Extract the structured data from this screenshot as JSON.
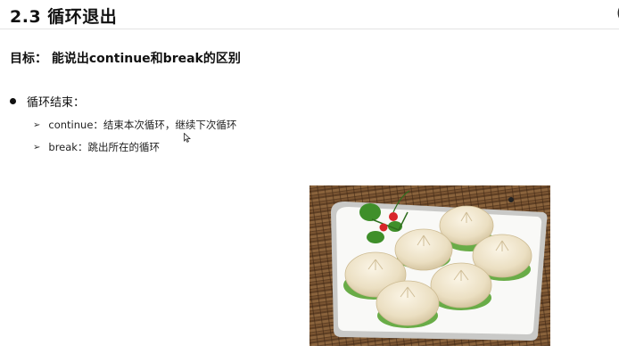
{
  "slide": {
    "title": "2.3 循环退出",
    "goal": "目标： 能说出continue和break的区别",
    "bullet": "循环结束：",
    "subitems": [
      {
        "text": "continue：结束本次循环，继续下次循环"
      },
      {
        "text": "break：跳出所在的循环"
      }
    ],
    "edge_glyph": "(",
    "arrow_glyph": "➢"
  },
  "photo": {
    "description": "steamed buns on a white plate with cilantro and red berries on a bamboo mat"
  },
  "colors": {
    "title": "#111111",
    "mat": "#6b4a2e",
    "plate": "#f7f7f5",
    "bun": "#efe6cf",
    "leaf": "#3f8f2a",
    "berry": "#d8262a"
  }
}
